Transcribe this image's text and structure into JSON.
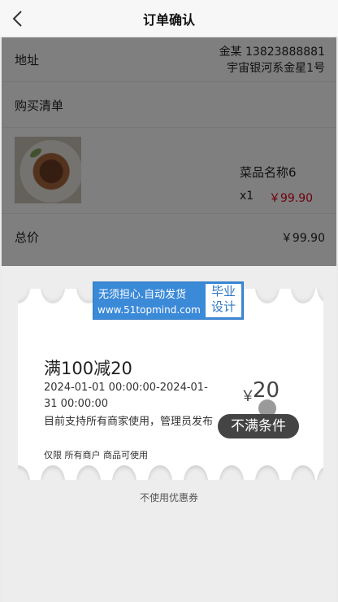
{
  "nav": {
    "title": "订单确认",
    "back_icon": "chevron-left-icon"
  },
  "order": {
    "address": {
      "label": "地址",
      "name_phone": "金某 13823888881",
      "address": "宇宙银河系金星1号"
    },
    "cart": {
      "label": "购买清单"
    },
    "item": {
      "name": "菜品名称6",
      "qty": "x1",
      "price": "￥99.90"
    },
    "total": {
      "label": "总价",
      "value": "￥99.90"
    }
  },
  "coupon": {
    "title": "满100减20",
    "validity": "2024-01-01 00:00:00-2024-01-31 00:00:00",
    "description": "目前支持所有商家使用，管理员发布",
    "scope": "仅限 所有商户 商品可使用",
    "currency": "￥",
    "amount": "20",
    "status": "不满条件"
  },
  "no_coupon_label": "不使用优惠券",
  "watermark": {
    "line1": "无须担心.自动发货",
    "line2": "www.51topmind.com",
    "box1": "毕业",
    "box2": "设计"
  },
  "colors": {
    "price_red": "#d9001b",
    "badge_bg": "#444444",
    "sheet_bg": "#ededed",
    "watermark_blue": "#3b8ad8"
  }
}
